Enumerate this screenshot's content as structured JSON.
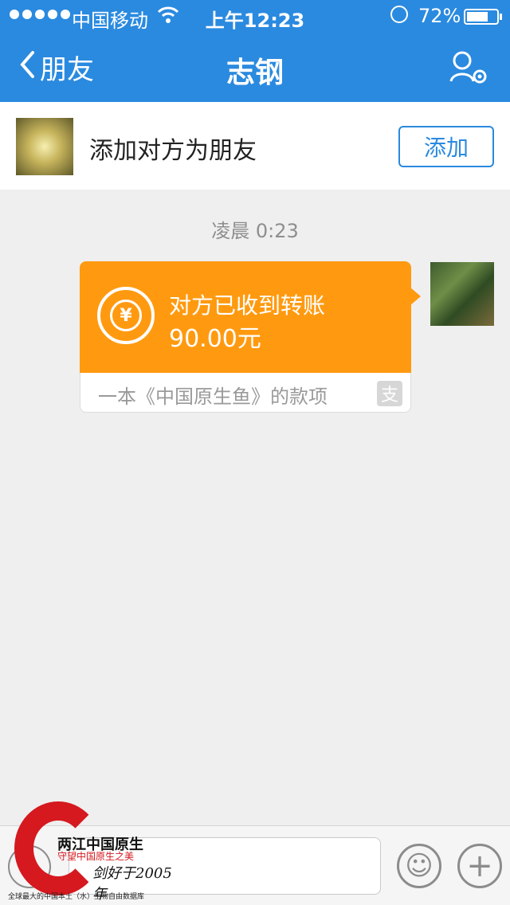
{
  "status_bar": {
    "carrier": "中国移动",
    "time": "上午12:23",
    "battery": "72%",
    "battery_level": 0.72
  },
  "nav": {
    "back_label": "朋友",
    "title": "志钢"
  },
  "add_friend": {
    "prompt": "添加对方为朋友",
    "button_label": "添加"
  },
  "chat": {
    "timestamp": "凌晨 0:23",
    "transfer": {
      "title": "对方已收到转账",
      "amount": "90.00元",
      "note": "一本《中国原生鱼》的款项",
      "icon_char": "¥",
      "alipay_char": "支"
    }
  },
  "input_bar": {
    "emoji_glyph": "☺",
    "plus_glyph": "+"
  },
  "watermark": {
    "title": "两江中国原生",
    "slogan": "守望中国原生之美",
    "signature": "剑好于2005年",
    "footer": "全球最大的中国本土（水）生物自由数据库"
  },
  "colors": {
    "accent": "#2a8adf",
    "transfer_orange": "#ff9a10",
    "watermark_red": "#d5191f"
  }
}
